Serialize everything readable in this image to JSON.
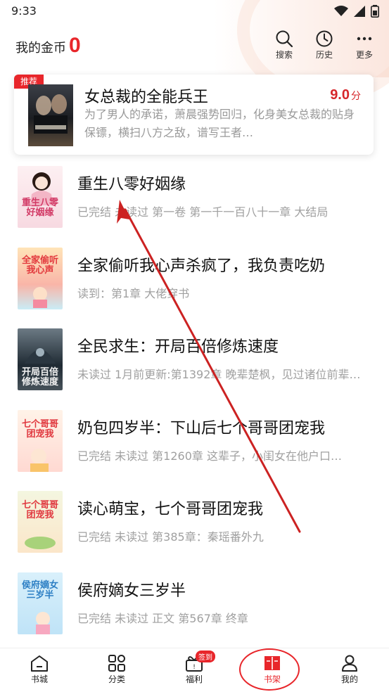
{
  "status_bar": {
    "time": "9:33"
  },
  "header": {
    "coins_label": "我的金币",
    "coins_value": "0",
    "actions": [
      {
        "label": "搜索",
        "icon": "search-icon"
      },
      {
        "label": "历史",
        "icon": "clock-icon"
      },
      {
        "label": "更多",
        "icon": "more-icon"
      }
    ]
  },
  "recommend": {
    "tag": "推荐",
    "title": "女总裁的全能兵王",
    "score": "9.0",
    "score_unit": "分",
    "description": "为了男人的承诺，萧晨强势回归，化身美女总裁的贴身保镖，横扫八方之敌，谱写王者…"
  },
  "books": [
    {
      "title": "重生八零好姻缘",
      "subtitle": "已完结 未读过 第一卷 第一千一百八十一章 大结局",
      "cover_text": "重生八零好姻缘"
    },
    {
      "title": "全家偷听我心声杀疯了，我负责吃奶",
      "subtitle": "读到：第1章 大佬穿书",
      "cover_text": "全家偷听我心声"
    },
    {
      "title": "全民求生：开局百倍修炼速度",
      "subtitle": "未读过 1月前更新:第1392章 晚辈楚枫，见过诸位前辈…",
      "cover_text": "开局百倍修炼速度"
    },
    {
      "title": "奶包四岁半：下山后七个哥哥团宠我",
      "subtitle": "已完结 未读过 第1260章 这辈子，小闺女在他户口…",
      "cover_text": "七个哥哥团宠我"
    },
    {
      "title": "读心萌宝，七个哥哥团宠我",
      "subtitle": "已完结 未读过 第385章：秦瑶番外九",
      "cover_text": "七个哥哥团宠我"
    },
    {
      "title": "侯府嫡女三岁半",
      "subtitle": "已完结 未读过 正文 第567章 终章",
      "cover_text": "侯府嫡女三岁半"
    }
  ],
  "bottom_nav": {
    "items": [
      {
        "label": "书城",
        "icon": "home-icon"
      },
      {
        "label": "分类",
        "icon": "category-icon"
      },
      {
        "label": "福利",
        "icon": "gift-icon",
        "badge": "签到"
      },
      {
        "label": "书架",
        "icon": "bookshelf-icon",
        "active": true
      },
      {
        "label": "我的",
        "icon": "profile-icon"
      }
    ]
  },
  "colors": {
    "accent": "#e8262b",
    "annotation": "#cc2222"
  }
}
